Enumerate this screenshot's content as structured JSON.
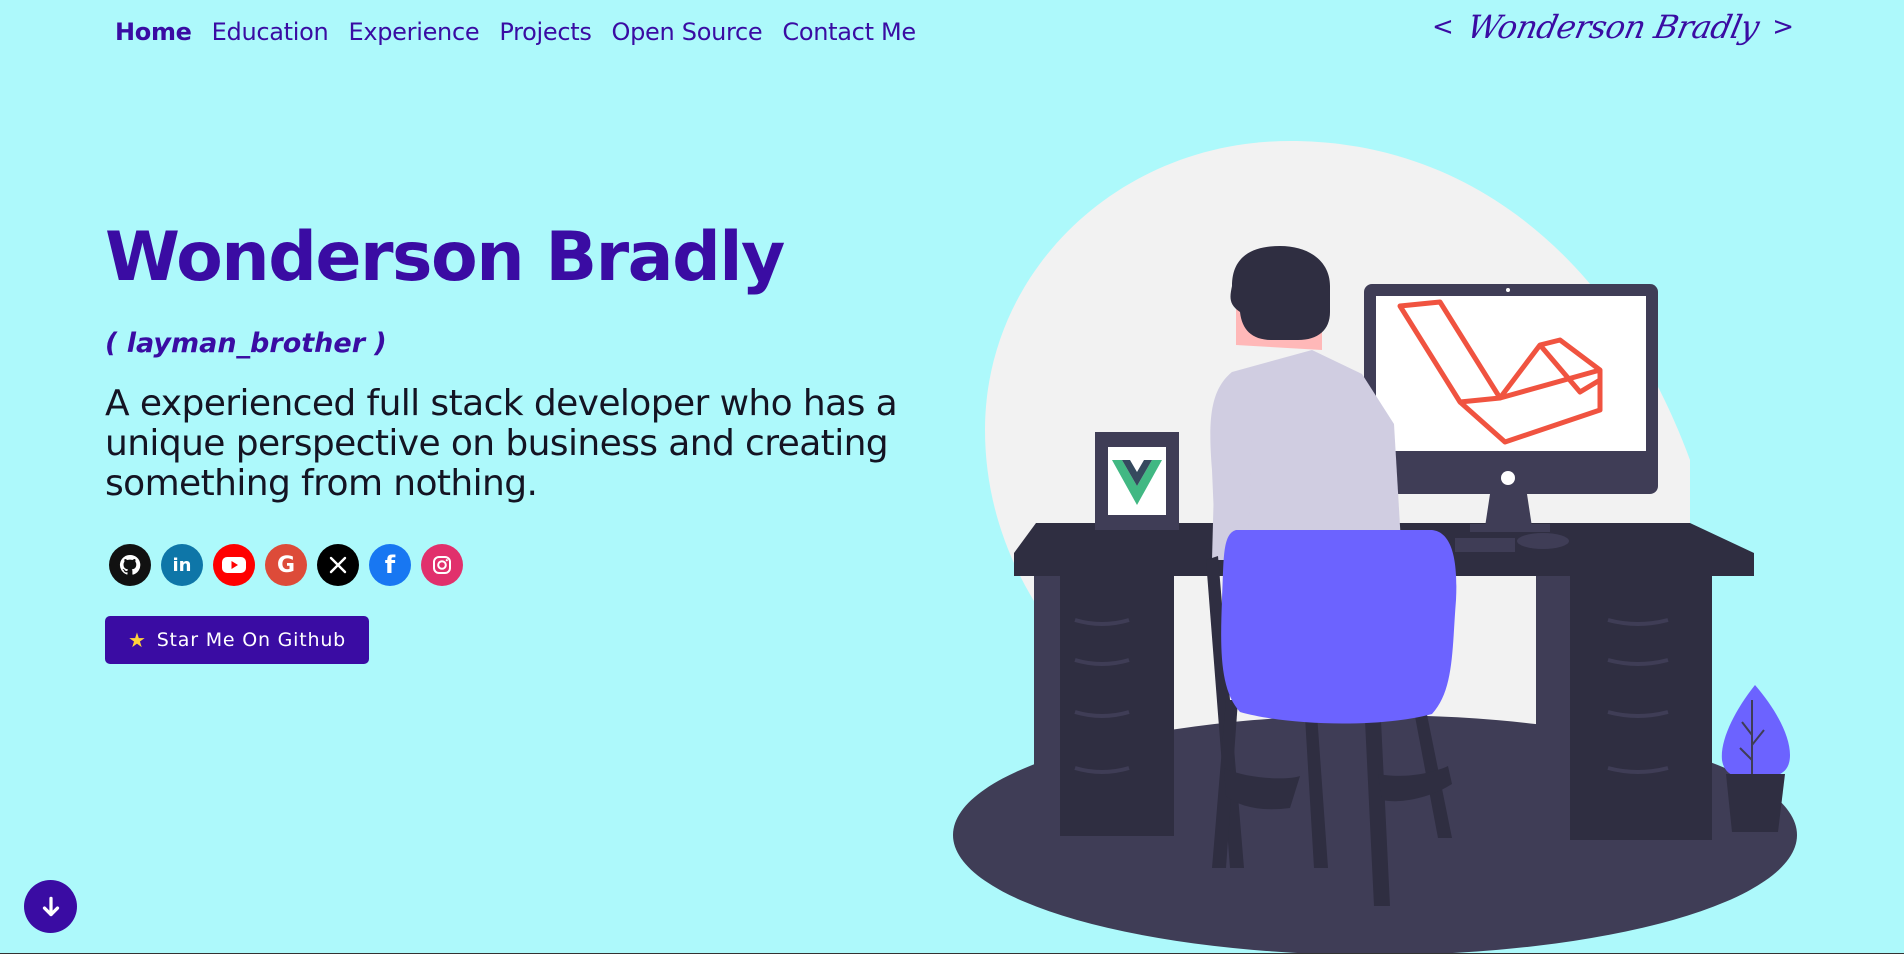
{
  "nav": {
    "items": [
      {
        "label": "Home",
        "active": true
      },
      {
        "label": "Education"
      },
      {
        "label": "Experience"
      },
      {
        "label": "Projects"
      },
      {
        "label": "Open Source"
      },
      {
        "label": "Contact Me"
      }
    ]
  },
  "logo": {
    "open": "<",
    "signature": "Wonderson Bradly",
    "close": ">"
  },
  "hero": {
    "title": "Wonderson Bradly",
    "alias": "( layman_brother )",
    "description": "A experienced full stack developer who has a unique perspective on business and creating something from nothing.",
    "cta_label": "Star Me On Github",
    "cta_icon": "star-icon"
  },
  "socials": [
    {
      "name": "github-icon",
      "color": "#111111",
      "glyph": "◉"
    },
    {
      "name": "linkedin-icon",
      "color": "#0e76a8",
      "glyph": "in"
    },
    {
      "name": "youtube-icon",
      "color": "#ff0000",
      "glyph": "▶"
    },
    {
      "name": "google-icon",
      "color": "#dd4b39",
      "glyph": "G"
    },
    {
      "name": "x-icon",
      "color": "#000000",
      "glyph": "✕"
    },
    {
      "name": "facebook-icon",
      "color": "#1877f2",
      "glyph": "f"
    },
    {
      "name": "instagram-icon",
      "color": "#e1306c",
      "glyph": "◎"
    }
  ],
  "colors": {
    "background": "#adf9fb",
    "brand": "#3a0ca3",
    "chair": "#6c63ff",
    "laravel": "#f05340",
    "vue": "#41b883"
  },
  "scroll_button": {
    "icon": "arrow-down-icon"
  }
}
